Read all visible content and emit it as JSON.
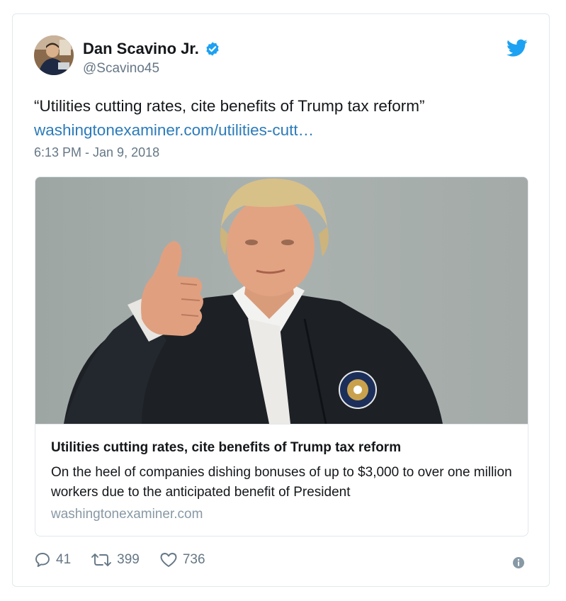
{
  "author": {
    "display_name": "Dan Scavino Jr.",
    "handle": "@Scavino45",
    "verified_icon": "verified-badge-icon",
    "platform_icon": "twitter-bird-icon"
  },
  "tweet": {
    "text": "“Utilities cutting rates, cite benefits of Trump tax reform”",
    "link": "washingtonexaminer.com/utilities-cutt…",
    "timestamp": "6:13 PM - Jan 9, 2018"
  },
  "link_card": {
    "title": "Utilities cutting rates, cite benefits of Trump tax reform",
    "description": "On the heel of companies dishing bonuses of up to $3,000 to over one million workers due to the anticipated benefit of President",
    "domain": "washingtonexaminer.com"
  },
  "actions": {
    "replies": "41",
    "retweets": "399",
    "likes": "736"
  },
  "colors": {
    "accent": "#1da1f2",
    "link": "#2b7bb9",
    "secondary_text": "#657786",
    "border": "#e1e8ed"
  }
}
